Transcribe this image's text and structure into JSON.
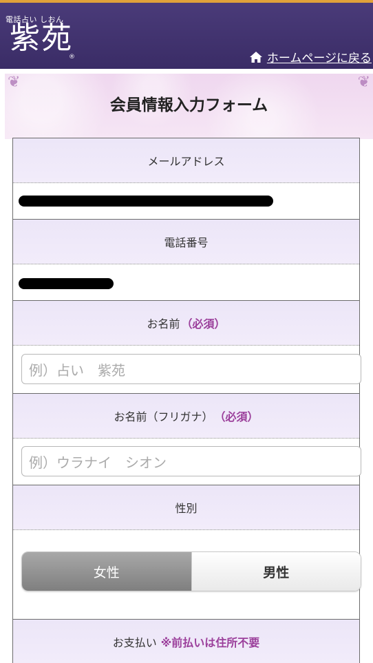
{
  "header": {
    "logo_small": "電話占い しおん",
    "logo_big": "紫苑",
    "logo_mark": "®",
    "home_link": "ホームページに戻る",
    "home_icon": "home-icon"
  },
  "title": "会員情報入力フォーム",
  "fields": {
    "email_label": "メールアドレス",
    "phone_label": "電話番号",
    "name_label": "お名前",
    "name_required": "（必須）",
    "name_placeholder": "例）占い　紫苑",
    "kana_label": "お名前（フリガナ）",
    "kana_required": "（必須）",
    "kana_placeholder": "例）ウラナイ　シオン",
    "gender_label": "性別",
    "gender_female": "女性",
    "gender_male": "男性",
    "gender_selected": "女性",
    "payment_label": "お支払い",
    "payment_note": "※前払いは住所不要"
  },
  "colors": {
    "header_bg": "#3a2c66",
    "accent_gold": "#e0a23a",
    "required": "#9b3f9b",
    "label_bg": "#ece6f8"
  }
}
